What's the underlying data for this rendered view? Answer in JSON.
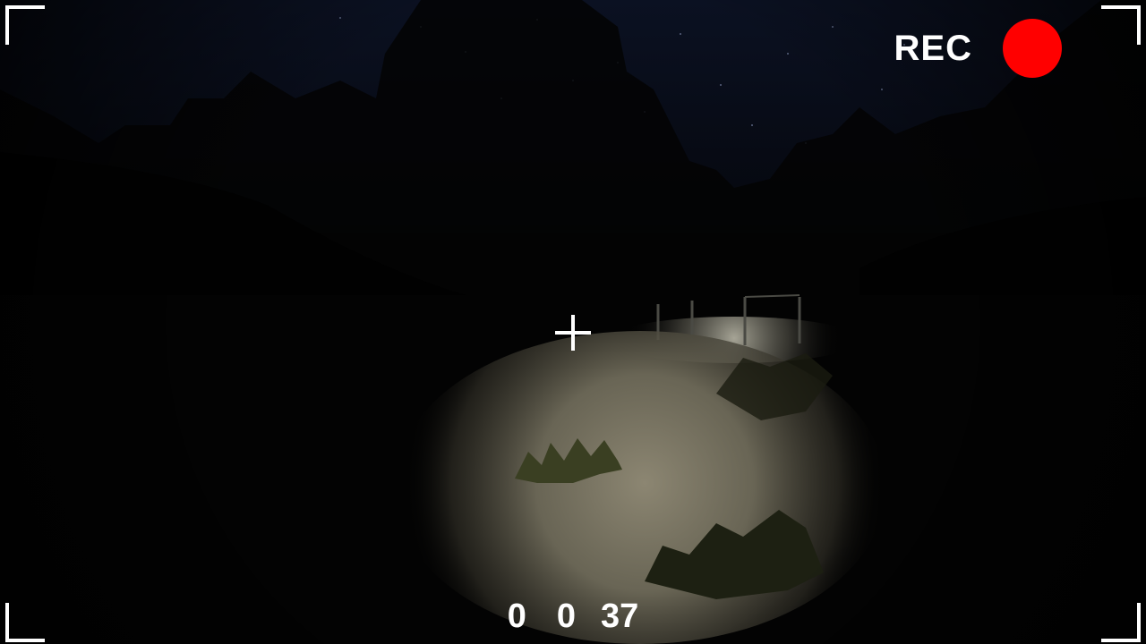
{
  "hud": {
    "rec_label": "REC",
    "rec_color": "#ff0000",
    "timer": {
      "hours": "0",
      "minutes": "0",
      "seconds": "37"
    }
  },
  "scene": {
    "description_colors": {
      "sky": "#0a0f1e",
      "ground_lit": "#8c8672",
      "foliage": "#0b0d08"
    }
  }
}
